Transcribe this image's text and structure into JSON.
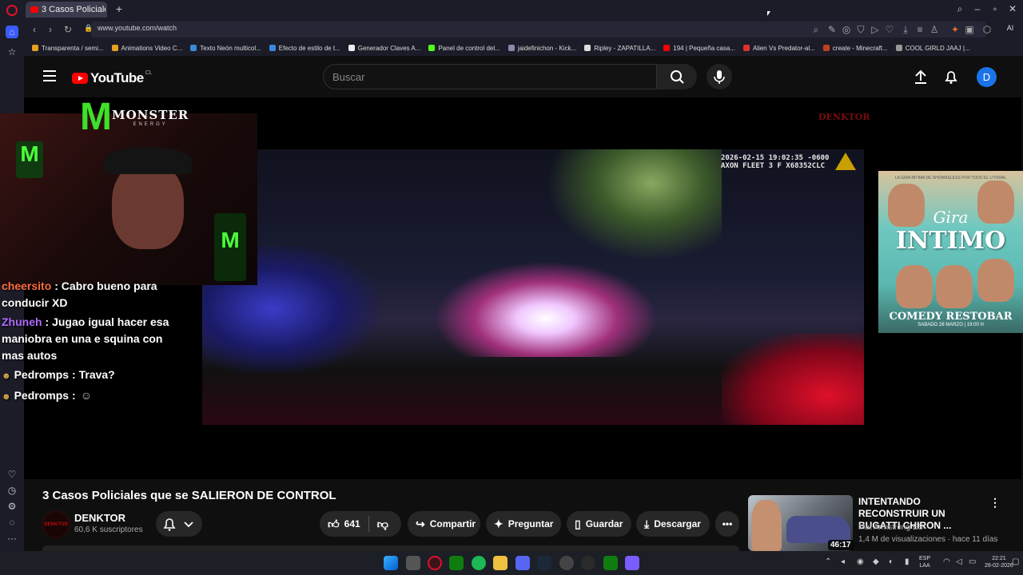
{
  "browser": {
    "tab_title": "3 Casos Policiales que se SALIERON DE CONTROL",
    "url": "www.youtube.com/watch",
    "ai_label": "AI",
    "bookmarks": [
      "Transparenta / semi...",
      "Animations Video C...",
      "Texto Neón multicol...",
      "Efecto de estilo de t...",
      "Generador Claves A...",
      "Panel de control del...",
      "jaidefinichon - Kick...",
      "Ripley - ZAPATILLA...",
      "194 | Pequeña casa...",
      "Alien Vs Predator-al...",
      "create - Minecraft...",
      "COOL GIRLD JAAJ |..."
    ]
  },
  "youtube": {
    "logo_text": "YouTube",
    "country": "CL",
    "search_placeholder": "Buscar",
    "avatar_letter": "D"
  },
  "video": {
    "bodycam_line1": "2026-02-15 19:02:35 -0600",
    "bodycam_line2": "AXON FLEET 3 F X68352CLC",
    "brand_name": "MONSTER",
    "brand_sub": "ENERGY",
    "channel_mark": "DENKTOR",
    "chat": [
      {
        "user": "cheersito",
        "text": ": Cabro bueno para conducir XD",
        "color": "#ff6b3d"
      },
      {
        "user": "Zhuneh",
        "text": ": Jugao igual hacer esa maniobra en una e squina con mas autos",
        "color": "#b06bff"
      },
      {
        "user": "Pedromps",
        "text": ": Trava?",
        "color": "#ffffff"
      },
      {
        "user": "Pedromps",
        "text": ":",
        "color": "#ffffff"
      }
    ],
    "ad": {
      "top_text": "LA GIRA INTIMA DE SHOWKELESS POR TODO EL LITORAL",
      "gira": "Gira",
      "intimo": "INTIMO",
      "venue": "COMEDY RESTOBAR",
      "date": "SABADO 28 MARZO | 19:00 H"
    }
  },
  "info": {
    "title": "3 Casos Policiales que se SALIERON DE CONTROL",
    "channel": "DENKTOR",
    "subscribers": "60,6 K suscriptores",
    "likes": "641",
    "share": "Compartir",
    "ask": "Preguntar",
    "save": "Guardar",
    "download": "Descargar"
  },
  "recommended": {
    "title": "INTENTANDO RECONSTRUIR UN BUGATTI CHIRON ...",
    "channel": "Mat Armstrong ES",
    "meta": "1,4 M de visualizaciones · hace 11 días",
    "duration": "46:17"
  },
  "taskbar": {
    "lang1": "ESP",
    "lang2": "LAA",
    "time": "22:21",
    "date": "26-02-2026"
  },
  "colors": {
    "youtube_red": "#ff0000",
    "avatar_blue": "#1a73e8",
    "monster_green": "#3fe02a"
  }
}
